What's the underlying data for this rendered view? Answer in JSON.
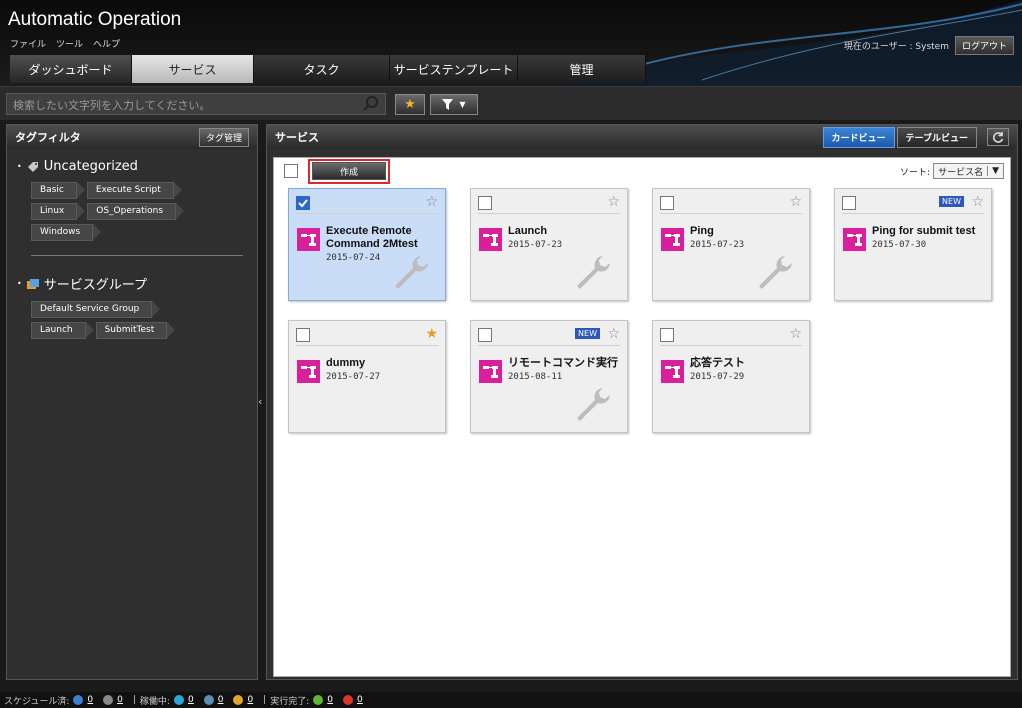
{
  "app": {
    "title": "Automatic Operation",
    "menu": [
      "ファイル",
      "ツール",
      "ヘルプ"
    ],
    "user_label": "現在のユーザー : System",
    "logout": "ログアウト"
  },
  "tabs": [
    {
      "label": "ダッシュボード",
      "active": false
    },
    {
      "label": "サービス",
      "active": true
    },
    {
      "label": "タスク",
      "active": false
    },
    {
      "label": "サービステンプレート",
      "active": false
    },
    {
      "label": "管理",
      "active": false
    }
  ],
  "search": {
    "placeholder": "検索したい文字列を入力してください。"
  },
  "tagfilter": {
    "title": "タグフィルタ",
    "manage_button": "タグ管理",
    "groups": [
      {
        "name": "Uncategorized",
        "icon": "tag-icon",
        "rows": [
          [
            "Basic",
            "Execute Script"
          ],
          [
            "Linux",
            "OS_Operations"
          ],
          [
            "Windows"
          ]
        ]
      },
      {
        "name": "サービスグループ",
        "icon": "service-group-icon",
        "rows": [
          [
            "Default Service Group"
          ],
          [
            "Launch",
            "SubmitTest"
          ]
        ]
      }
    ]
  },
  "main": {
    "title": "サービス",
    "views": {
      "card": "カードビュー",
      "table": "テーブルビュー"
    },
    "create_button": "作成",
    "sort_label": "ソート:",
    "sort_value": "サービス名"
  },
  "cards": [
    {
      "name": "Execute Remote Command 2Mtest",
      "date": "2015-07-24",
      "checked": true,
      "favorite": false,
      "new": false,
      "wrench": true,
      "selected": true
    },
    {
      "name": "Launch",
      "date": "2015-07-23",
      "checked": false,
      "favorite": false,
      "new": false,
      "wrench": true,
      "selected": false
    },
    {
      "name": "Ping",
      "date": "2015-07-23",
      "checked": false,
      "favorite": false,
      "new": false,
      "wrench": true,
      "selected": false
    },
    {
      "name": "Ping for submit test",
      "date": "2015-07-30",
      "checked": false,
      "favorite": false,
      "new": true,
      "wrench": false,
      "selected": false
    },
    {
      "name": "dummy",
      "date": "2015-07-27",
      "checked": false,
      "favorite": true,
      "new": false,
      "wrench": false,
      "selected": false
    },
    {
      "name": "リモートコマンド実行",
      "date": "2015-08-11",
      "checked": false,
      "favorite": false,
      "new": true,
      "wrench": true,
      "selected": false
    },
    {
      "name": "応答テスト",
      "date": "2015-07-29",
      "checked": false,
      "favorite": false,
      "new": false,
      "wrench": false,
      "selected": false
    }
  ],
  "new_badge": "NEW",
  "status": {
    "scheduled_label": "スケジュール済:",
    "scheduled_counts": [
      "0",
      "0"
    ],
    "running_label": "稼働中:",
    "running_counts": [
      "0",
      "0",
      "0"
    ],
    "done_label": "実行完了:",
    "done_counts": [
      "0",
      "0"
    ]
  },
  "colors": {
    "accent": "#2a6ac6",
    "service_icon": "#d91f9c",
    "highlight": "#e3262c"
  }
}
